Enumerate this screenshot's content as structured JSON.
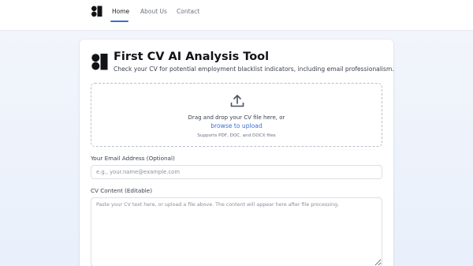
{
  "nav": {
    "links": [
      {
        "label": "Home",
        "active": true
      },
      {
        "label": "About Us",
        "active": false
      },
      {
        "label": "Contact",
        "active": false
      }
    ],
    "logo_icon": "brand-mark-icon"
  },
  "header": {
    "title": "First CV AI Analysis Tool",
    "subtitle": "Check your CV for potential employment blacklist indicators, including email professionalism."
  },
  "upload": {
    "icon": "upload-icon",
    "instruction": "Drag and drop your CV file here, or",
    "browse_label": "browse to upload",
    "supported": "Supports PDF, DOC, and DOCX files"
  },
  "email": {
    "label": "Your Email Address (Optional)",
    "value": "",
    "placeholder": "e.g., your.name@example.com"
  },
  "cv": {
    "label": "CV Content (Editable)",
    "value": "",
    "placeholder": "Paste your CV text here, or upload a file above. The content will appear here after file processing."
  },
  "colors": {
    "accent": "#3b6fd4",
    "background": "#eef3fb",
    "text": "#1a1d23"
  }
}
